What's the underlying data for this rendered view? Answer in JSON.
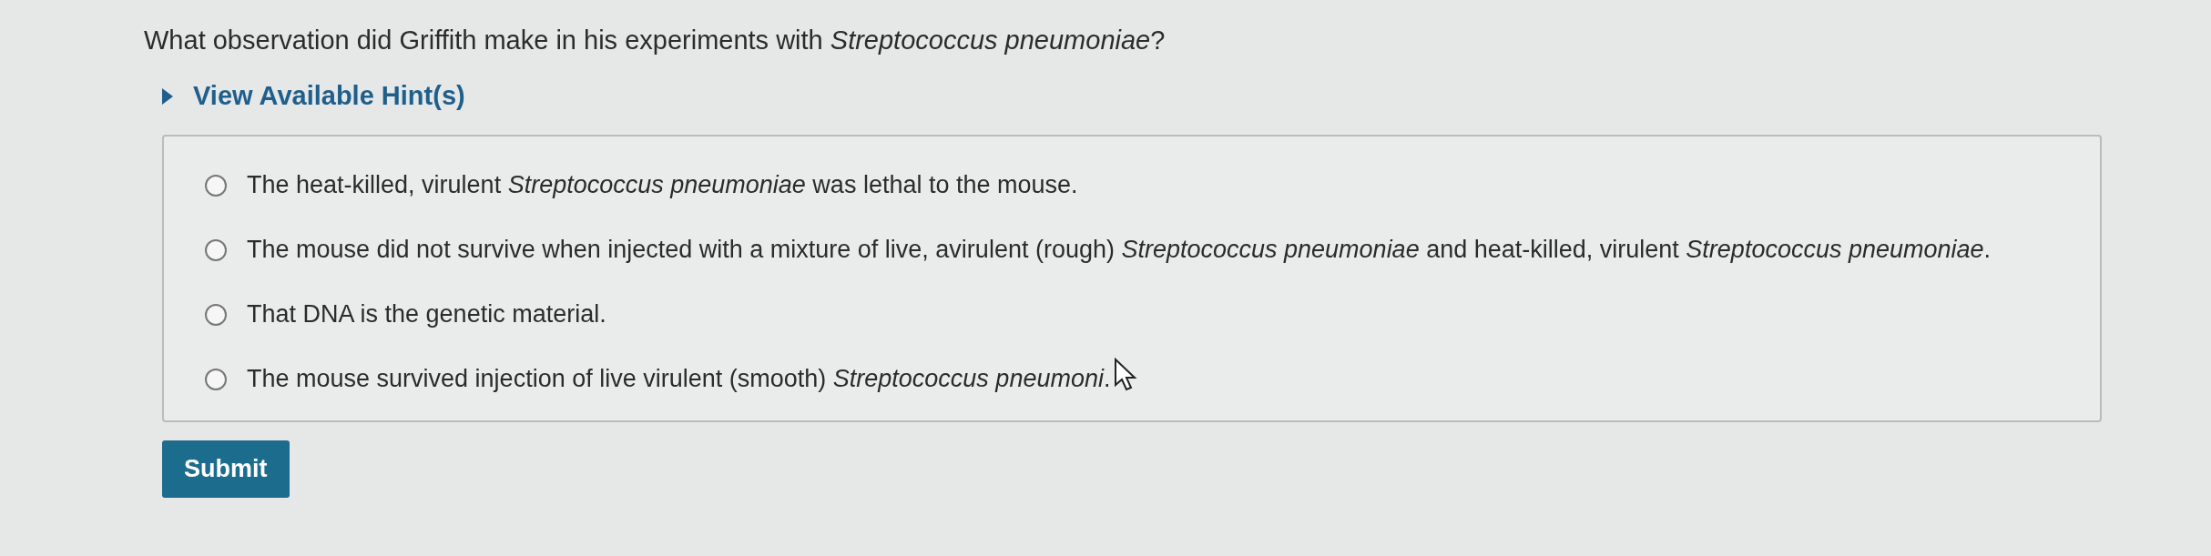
{
  "question": "What observation did Griffith make in his experiments with *Streptococcus pneumoniae*?",
  "hint": {
    "label": "View Available Hint(s)",
    "expanded": false
  },
  "options": [
    {
      "text": "The heat-killed, virulent *Streptococcus pneumoniae* was lethal to the mouse.",
      "selected": false
    },
    {
      "text": "The mouse did not survive when injected with a mixture of live, avirulent (rough) *Streptococcus pneumoniae* and heat-killed, virulent *Streptococcus pneumoniae*.",
      "selected": false
    },
    {
      "text": "That DNA is the genetic material.",
      "selected": false
    },
    {
      "text": "The mouse survived injection of live virulent (smooth) *Streptococcus pneumoni*.",
      "selected": false
    }
  ],
  "submit": "Submit"
}
